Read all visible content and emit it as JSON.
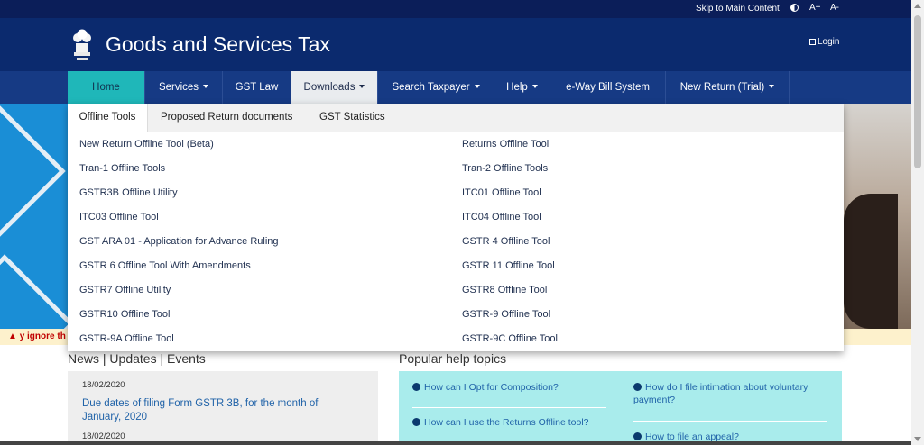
{
  "topbar": {
    "skip_label": "Skip to Main Content",
    "font_increase_label": "A+",
    "font_decrease_label": "A-"
  },
  "header": {
    "title": "Goods and Services Tax",
    "login_label": "Login"
  },
  "nav": {
    "items": [
      {
        "label": "Home"
      },
      {
        "label": "Services"
      },
      {
        "label": "GST Law"
      },
      {
        "label": "Downloads"
      },
      {
        "label": "Search Taxpayer"
      },
      {
        "label": "Help"
      },
      {
        "label": "e-Way Bill System"
      },
      {
        "label": "New Return (Trial)"
      }
    ]
  },
  "dropdown": {
    "tabs": [
      {
        "label": "Offline Tools"
      },
      {
        "label": "Proposed Return documents"
      },
      {
        "label": "GST Statistics"
      }
    ],
    "left_links": [
      "New Return Offline Tool (Beta)",
      "Tran-1 Offline Tools",
      "GSTR3B Offline Utility",
      "ITC03 Offline Tool",
      "GST ARA 01 - Application for Advance Ruling",
      "GSTR 6 Offline Tool With Amendments",
      "GSTR7 Offline Utility",
      "GSTR10 Offline Tool",
      "GSTR-9A Offline Tool"
    ],
    "right_links": [
      "Returns Offline Tool",
      "Tran-2 Offline Tools",
      "ITC01 Offline Tool",
      "ITC04 Offline Tool",
      "GSTR 4 Offline Tool",
      "GSTR 11 Offline Tool",
      "GSTR8 Offline Tool",
      "GSTR-9 Offline Tool",
      "GSTR-9C Offline Tool"
    ]
  },
  "ticker": {
    "text": "y ignore th"
  },
  "news": {
    "section_title": "News | Updates | Events",
    "items": [
      {
        "date": "18/02/2020",
        "headline": "Due dates of filing Form GSTR 3B, for the month of January, 2020"
      },
      {
        "date": "18/02/2020"
      }
    ]
  },
  "help": {
    "section_title": "Popular help topics",
    "links": [
      "How can I Opt for Composition?",
      "How can I use the Returns Offline tool?",
      "How do I file intimation about voluntary payment?",
      "How to file an appeal?"
    ]
  },
  "colors": {
    "topbar_bg": "#0b1e59",
    "header_bg": "#0b2a6e",
    "nav_bg": "#163a84",
    "home_tab_bg": "#1fb7b9",
    "link_color": "#1f62a8",
    "help_bg": "#a9ecec"
  }
}
